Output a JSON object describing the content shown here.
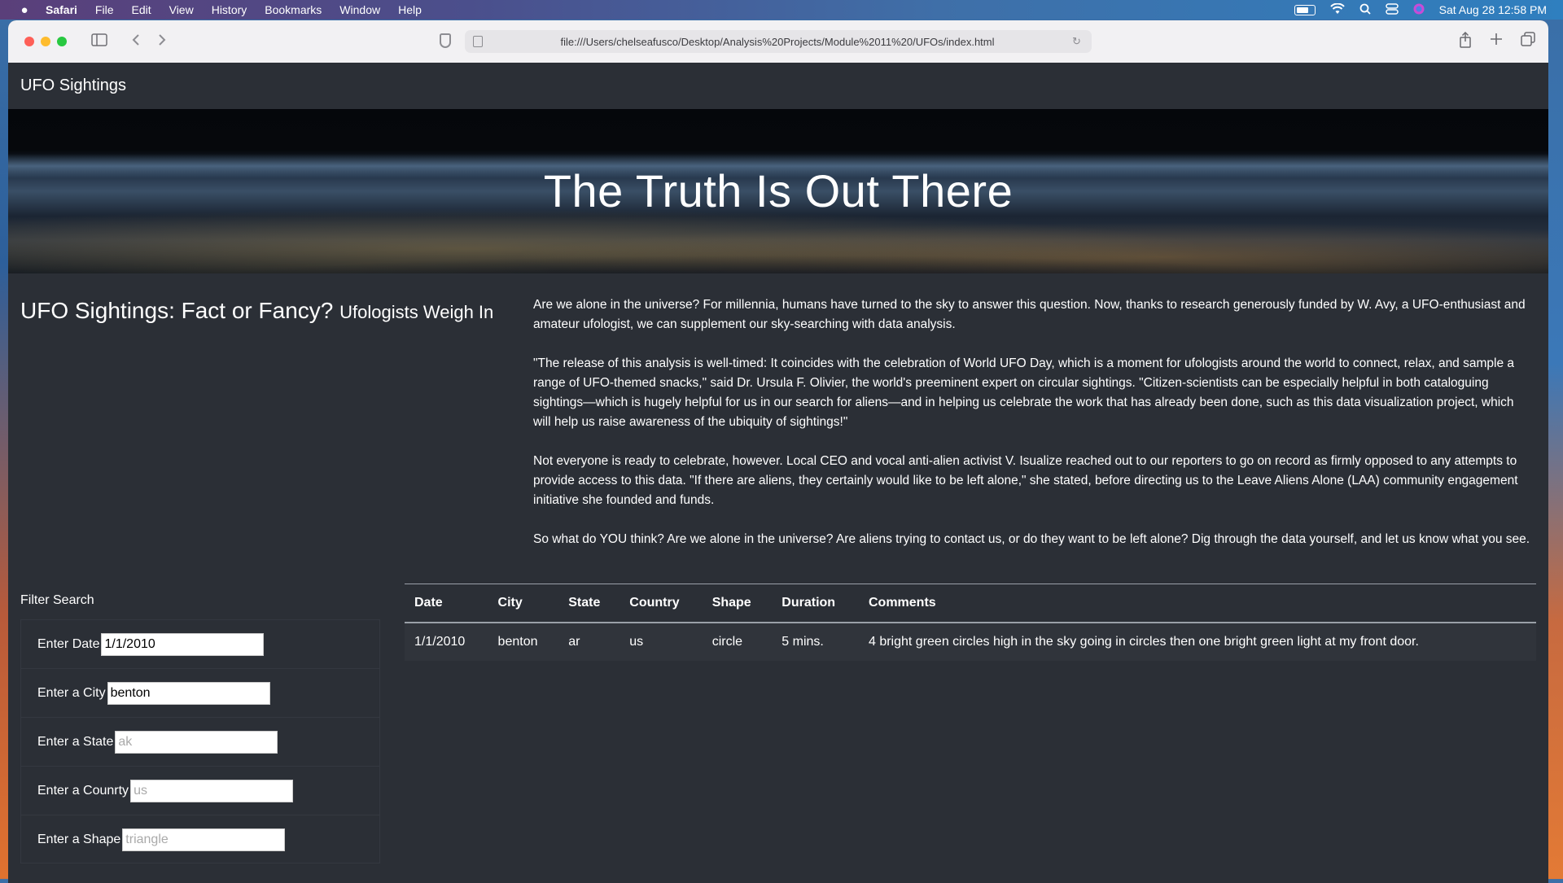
{
  "menubar": {
    "app": "Safari",
    "items": [
      "File",
      "Edit",
      "View",
      "History",
      "Bookmarks",
      "Window",
      "Help"
    ],
    "datetime": "Sat Aug 28  12:58 PM"
  },
  "browser": {
    "url": "file:///Users/chelseafusco/Desktop/Analysis%20Projects/Module%2011%20/UFOs/index.html"
  },
  "page": {
    "brand": "UFO Sightings",
    "hero_title": "The Truth Is Out There",
    "heading": "UFO Sightings: Fact or Fancy?",
    "subheading": "Ufologists Weigh In",
    "paragraphs": [
      "Are we alone in the universe? For millennia, humans have turned to the sky to answer this question. Now, thanks to research generously funded by W. Avy, a UFO-enthusiast and amateur ufologist, we can supplement our sky-searching with data analysis.",
      "\"The release of this analysis is well-timed: It coincides with the celebration of World UFO Day, which is a moment for ufologists around the world to connect, relax, and sample a range of UFO-themed snacks,\" said Dr. Ursula F. Olivier, the world's preeminent expert on circular sightings. \"Citizen-scientists can be especially helpful in both cataloguing sightings—which is hugely helpful for us in our search for aliens—and in helping us celebrate the work that has already been done, such as this data visualization project, which will help us raise awareness of the ubiquity of sightings!\"",
      "Not everyone is ready to celebrate, however. Local CEO and vocal anti-alien activist V. Isualize reached out to our reporters to go on record as firmly opposed to any attempts to provide access to this data. \"If there are aliens, they certainly would like to be left alone,\" she stated, before directing us to the Leave Aliens Alone (LAA) community engagement initiative she founded and funds.",
      "So what do YOU think? Are we alone in the universe? Are aliens trying to contact us, or do they want to be left alone? Dig through the data yourself, and let us know what you see."
    ]
  },
  "filters": {
    "title": "Filter Search",
    "date": {
      "label": "Enter Date",
      "value": "1/1/2010",
      "placeholder": ""
    },
    "city": {
      "label": "Enter a City",
      "value": "benton",
      "placeholder": ""
    },
    "state": {
      "label": "Enter a State",
      "value": "",
      "placeholder": "ak"
    },
    "country": {
      "label": "Enter a Counrty",
      "value": "",
      "placeholder": "us"
    },
    "shape": {
      "label": "Enter a Shape",
      "value": "",
      "placeholder": "triangle"
    }
  },
  "table": {
    "headers": [
      "Date",
      "City",
      "State",
      "Country",
      "Shape",
      "Duration",
      "Comments"
    ],
    "rows": [
      [
        "1/1/2010",
        "benton",
        "ar",
        "us",
        "circle",
        "5 mins.",
        "4 bright green circles high in the sky going in circles then one bright green light at my front door."
      ]
    ]
  }
}
